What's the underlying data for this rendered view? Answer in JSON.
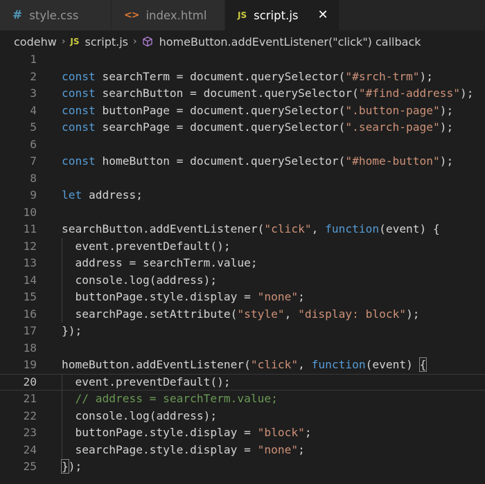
{
  "tabs": [
    {
      "label": "style.css",
      "icon": "css-file-icon",
      "icon_text": "#",
      "active": false
    },
    {
      "label": "index.html",
      "icon": "html-file-icon",
      "icon_text": "<>",
      "active": false
    },
    {
      "label": "script.js",
      "icon": "js-file-icon",
      "icon_text": "JS",
      "active": true,
      "close_glyph": "✕"
    }
  ],
  "breadcrumb": {
    "folder": "codehw",
    "file": "script.js",
    "file_icon_text": "JS",
    "symbol": "homeButton.addEventListener(\"click\") callback",
    "separator": "›"
  },
  "colors": {
    "keyword": "#569cd6",
    "string": "#ce9178",
    "comment": "#6a9955",
    "text": "#d4d4d4",
    "line_number": "#858585",
    "background": "#1e1e1e"
  },
  "code": {
    "current_line": 20,
    "lines": [
      {
        "n": "1",
        "tokens": []
      },
      {
        "n": "2",
        "tokens": [
          {
            "t": "const",
            "c": "kw"
          },
          {
            "t": " searchTerm = document.querySelector(",
            "c": ""
          },
          {
            "t": "\"#srch-trm\"",
            "c": "str"
          },
          {
            "t": ");",
            "c": ""
          }
        ]
      },
      {
        "n": "3",
        "tokens": [
          {
            "t": "const",
            "c": "kw"
          },
          {
            "t": " searchButton = document.querySelector(",
            "c": ""
          },
          {
            "t": "\"#find-address\"",
            "c": "str"
          },
          {
            "t": ");",
            "c": ""
          }
        ]
      },
      {
        "n": "4",
        "tokens": [
          {
            "t": "const",
            "c": "kw"
          },
          {
            "t": " buttonPage = document.querySelector(",
            "c": ""
          },
          {
            "t": "\".button-page\"",
            "c": "str"
          },
          {
            "t": ");",
            "c": ""
          }
        ]
      },
      {
        "n": "5",
        "tokens": [
          {
            "t": "const",
            "c": "kw"
          },
          {
            "t": " searchPage = document.querySelector(",
            "c": ""
          },
          {
            "t": "\".search-page\"",
            "c": "str"
          },
          {
            "t": ");",
            "c": ""
          }
        ]
      },
      {
        "n": "6",
        "tokens": []
      },
      {
        "n": "7",
        "tokens": [
          {
            "t": "const",
            "c": "kw"
          },
          {
            "t": " homeButton = document.querySelector(",
            "c": ""
          },
          {
            "t": "\"#home-button\"",
            "c": "str"
          },
          {
            "t": ");",
            "c": ""
          }
        ]
      },
      {
        "n": "8",
        "tokens": []
      },
      {
        "n": "9",
        "tokens": [
          {
            "t": "let",
            "c": "kw"
          },
          {
            "t": " address;",
            "c": ""
          }
        ]
      },
      {
        "n": "10",
        "tokens": []
      },
      {
        "n": "11",
        "tokens": [
          {
            "t": "searchButton.addEventListener(",
            "c": ""
          },
          {
            "t": "\"click\"",
            "c": "str"
          },
          {
            "t": ", ",
            "c": ""
          },
          {
            "t": "function",
            "c": "kw"
          },
          {
            "t": "(event) {",
            "c": ""
          }
        ]
      },
      {
        "n": "12",
        "tokens": [
          {
            "t": "  event.preventDefault();",
            "c": ""
          }
        ]
      },
      {
        "n": "13",
        "tokens": [
          {
            "t": "  address = searchTerm.value;",
            "c": ""
          }
        ]
      },
      {
        "n": "14",
        "tokens": [
          {
            "t": "  console.log(address);",
            "c": ""
          }
        ]
      },
      {
        "n": "15",
        "tokens": [
          {
            "t": "  buttonPage.style.display = ",
            "c": ""
          },
          {
            "t": "\"none\"",
            "c": "str"
          },
          {
            "t": ";",
            "c": ""
          }
        ]
      },
      {
        "n": "16",
        "tokens": [
          {
            "t": "  searchPage.setAttribute(",
            "c": ""
          },
          {
            "t": "\"style\"",
            "c": "str"
          },
          {
            "t": ", ",
            "c": ""
          },
          {
            "t": "\"display: block\"",
            "c": "str"
          },
          {
            "t": ");",
            "c": ""
          }
        ]
      },
      {
        "n": "17",
        "tokens": [
          {
            "t": "});",
            "c": ""
          }
        ]
      },
      {
        "n": "18",
        "tokens": []
      },
      {
        "n": "19",
        "tokens": [
          {
            "t": "homeButton.addEventListener(",
            "c": ""
          },
          {
            "t": "\"click\"",
            "c": "str"
          },
          {
            "t": ", ",
            "c": ""
          },
          {
            "t": "function",
            "c": "kw"
          },
          {
            "t": "(event) ",
            "c": ""
          },
          {
            "t": "{",
            "c": "bm"
          }
        ]
      },
      {
        "n": "20",
        "tokens": [
          {
            "t": "  event.preventDefault();",
            "c": ""
          }
        ]
      },
      {
        "n": "21",
        "tokens": [
          {
            "t": "  // address = searchTerm.value;",
            "c": "cm"
          }
        ]
      },
      {
        "n": "22",
        "tokens": [
          {
            "t": "  console.log(address);",
            "c": ""
          }
        ]
      },
      {
        "n": "23",
        "tokens": [
          {
            "t": "  buttonPage.style.display = ",
            "c": ""
          },
          {
            "t": "\"block\"",
            "c": "str"
          },
          {
            "t": ";",
            "c": ""
          }
        ]
      },
      {
        "n": "24",
        "tokens": [
          {
            "t": "  searchPage.style.display = ",
            "c": ""
          },
          {
            "t": "\"none\"",
            "c": "str"
          },
          {
            "t": ";",
            "c": ""
          }
        ]
      },
      {
        "n": "25",
        "tokens": [
          {
            "t": "}",
            "c": "bm"
          },
          {
            "t": ");",
            "c": ""
          }
        ]
      }
    ]
  }
}
